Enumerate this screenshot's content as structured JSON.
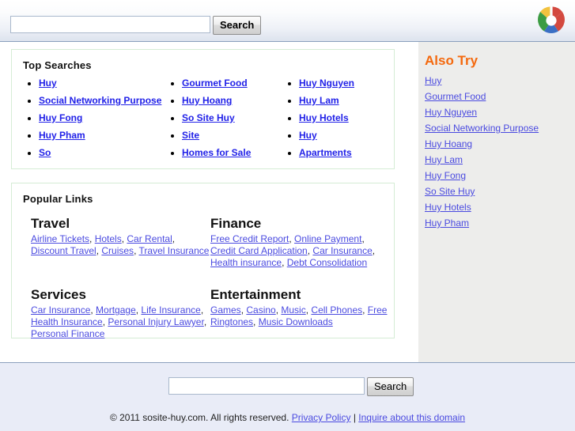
{
  "header": {
    "search_value": "",
    "search_placeholder": "",
    "search_button": "Search",
    "logo_name": "colorwheel-logo",
    "logo_colors": {
      "top_left": "#f2c23e",
      "top_right": "#d3493f",
      "bottom_left": "#3c9c43",
      "bottom_right": "#3b6fc4"
    }
  },
  "top_searches": {
    "title": "Top Searches",
    "columns": [
      [
        "Huy",
        "Social Networking Purpose",
        "Huy Fong",
        "Huy Pham",
        "So"
      ],
      [
        "Gourmet Food",
        "Huy Hoang",
        "So Site Huy",
        "Site",
        "Homes for Sale"
      ],
      [
        "Huy Nguyen",
        "Huy Lam",
        "Huy Hotels",
        "Huy",
        "Apartments"
      ]
    ]
  },
  "popular_links": {
    "title": "Popular Links",
    "categories": [
      {
        "heading": "Travel",
        "links": [
          "Airline Tickets",
          "Hotels",
          "Car Rental",
          "Discount Travel",
          "Cruises",
          "Travel Insurance"
        ]
      },
      {
        "heading": "Finance",
        "links": [
          "Free Credit Report",
          "Online Payment",
          "Credit Card Application",
          "Car Insurance",
          "Health insurance",
          "Debt Consolidation"
        ]
      },
      {
        "heading": "Services",
        "links": [
          "Car Insurance",
          "Mortgage",
          "Life Insurance",
          "Health Insurance",
          "Personal Injury Lawyer",
          "Personal Finance"
        ]
      },
      {
        "heading": "Entertainment",
        "links": [
          "Games",
          "Casino",
          "Music",
          "Cell Phones",
          "Free Ringtones",
          "Music Downloads"
        ]
      }
    ]
  },
  "also_try": {
    "title": "Also Try",
    "title_color": "#f4690e",
    "items": [
      "Huy",
      "Gourmet Food",
      "Huy Nguyen",
      "Social Networking Purpose",
      "Huy Hoang",
      "Huy Lam",
      "Huy Fong",
      "So Site Huy",
      "Huy Hotels",
      "Huy Pham"
    ]
  },
  "footer": {
    "search_value": "",
    "search_placeholder": "",
    "search_button": "Search",
    "copyright": "© 2011 sosite-huy.com. All rights reserved.",
    "privacy_policy": "Privacy Policy",
    "separator": "|",
    "inquire": "Inquire about this domain"
  }
}
